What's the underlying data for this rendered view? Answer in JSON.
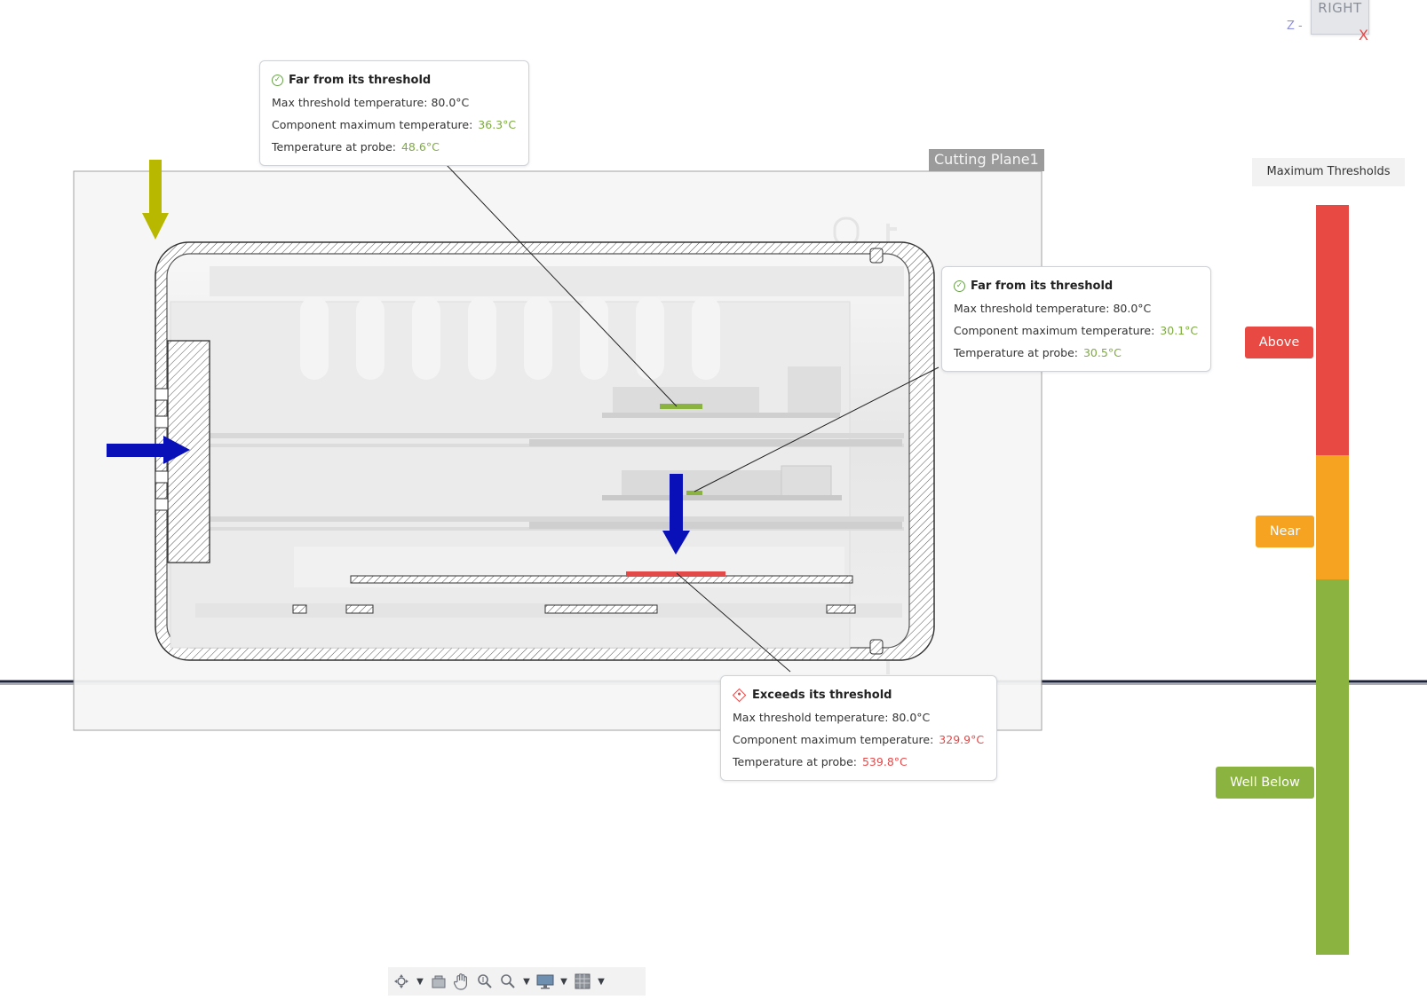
{
  "view_cube": {
    "face_label": "RIGHT",
    "axis_z": "Z",
    "axis_x": "X"
  },
  "cutting_plane": {
    "label": "Cutting Plane1"
  },
  "callouts": [
    {
      "status": "Far from its threshold",
      "status_kind": "ok",
      "max_threshold_label": "Max threshold temperature:",
      "max_threshold_value": "80.0°C",
      "component_max_label": "Component maximum temperature:",
      "component_max_value": "36.3°C",
      "probe_label": "Temperature at probe:",
      "probe_value": "48.6°C"
    },
    {
      "status": "Far from its threshold",
      "status_kind": "ok",
      "max_threshold_label": "Max threshold temperature:",
      "max_threshold_value": "80.0°C",
      "component_max_label": "Component maximum temperature:",
      "component_max_value": "30.1°C",
      "probe_label": "Temperature at probe:",
      "probe_value": "30.5°C"
    },
    {
      "status": "Exceeds its threshold",
      "status_kind": "bad",
      "max_threshold_label": "Max threshold temperature:",
      "max_threshold_value": "80.0°C",
      "component_max_label": "Component maximum temperature:",
      "component_max_value": "329.9°C",
      "probe_label": "Temperature at probe:",
      "probe_value": "539.8°C"
    }
  ],
  "legend": {
    "title": "Maximum Thresholds",
    "above_label": "Above",
    "near_label": "Near",
    "well_below_label": "Well Below",
    "colors": {
      "above": "#e84a43",
      "near": "#f5a321",
      "well_below": "#8ab43f"
    }
  },
  "colors": {
    "flow_arrow_inlet": "#b8b800",
    "flow_arrow_blue": "#0a10b8",
    "ok_text": "#7dab3f",
    "bad_text": "#e24a4a"
  },
  "toolbar": {
    "items": [
      "orbit-icon",
      "dropdown-caret-icon",
      "look-at-icon",
      "pan-icon",
      "zoom-icon",
      "zoom-window-icon",
      "dropdown-caret-icon",
      "display-settings-icon",
      "dropdown-caret-icon",
      "grid-icon",
      "dropdown-caret-icon"
    ]
  }
}
